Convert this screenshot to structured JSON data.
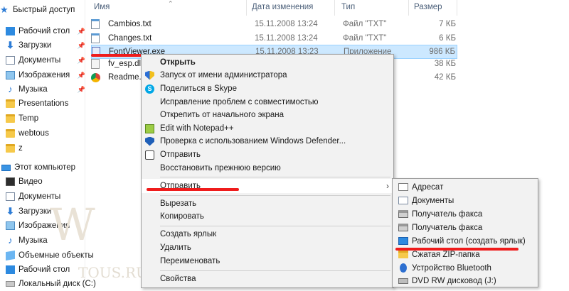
{
  "nav": {
    "items": [
      {
        "label": "Быстрый доступ",
        "icon": "star-icon",
        "pinned": false
      },
      {
        "label": "Рабочий стол",
        "icon": "desktop-icon",
        "pinned": true
      },
      {
        "label": "Загрузки",
        "icon": "download-icon",
        "pinned": true
      },
      {
        "label": "Документы",
        "icon": "documents-icon",
        "pinned": true
      },
      {
        "label": "Изображения",
        "icon": "pictures-icon",
        "pinned": true
      },
      {
        "label": "Музыка",
        "icon": "music-icon",
        "pinned": true
      },
      {
        "label": "Presentations",
        "icon": "folder-icon",
        "pinned": false
      },
      {
        "label": "Temp",
        "icon": "folder-icon",
        "pinned": false
      },
      {
        "label": "webtous",
        "icon": "folder-icon",
        "pinned": false
      },
      {
        "label": "z",
        "icon": "folder-icon",
        "pinned": false
      },
      {
        "label": "Этот компьютер",
        "icon": "computer-icon",
        "pinned": false
      },
      {
        "label": "Видео",
        "icon": "video-icon",
        "pinned": false
      },
      {
        "label": "Документы",
        "icon": "documents-icon",
        "pinned": false
      },
      {
        "label": "Загрузки",
        "icon": "download-icon",
        "pinned": false
      },
      {
        "label": "Изображения",
        "icon": "pictures-icon",
        "pinned": false
      },
      {
        "label": "Музыка",
        "icon": "music-icon",
        "pinned": false
      },
      {
        "label": "Объемные объекты",
        "icon": "3d-objects-icon",
        "pinned": false
      },
      {
        "label": "Рабочий стол",
        "icon": "desktop-icon",
        "pinned": false
      },
      {
        "label": "Локальный диск (C:)",
        "icon": "drive-icon",
        "pinned": false
      }
    ]
  },
  "columns": {
    "name": "Имя",
    "date": "Дата изменения",
    "type": "Тип",
    "size": "Размер"
  },
  "files": [
    {
      "name": "Cambios.txt",
      "date": "15.11.2008 13:24",
      "type": "Файл \"TXT\"",
      "size": "7 КБ",
      "icon": "text-file-icon"
    },
    {
      "name": "Changes.txt",
      "date": "15.11.2008 13:24",
      "type": "Файл \"TXT\"",
      "size": "6 КБ",
      "icon": "text-file-icon"
    },
    {
      "name": "FontViewer.exe",
      "date": "15.11.2008 13:23",
      "type": "Приложение",
      "size": "986 КБ",
      "icon": "exe-file-icon"
    },
    {
      "name": "fv_esp.dll",
      "date": "",
      "type": "",
      "size": "38 КБ",
      "icon": "dll-file-icon"
    },
    {
      "name": "Readme.h",
      "date": "",
      "type": "",
      "size": "42 КБ",
      "icon": "chrome-file-icon"
    }
  ],
  "context_menu": {
    "items": [
      {
        "label": "Открыть",
        "icon": "",
        "bold": true
      },
      {
        "label": "Запуск от имени администратора",
        "icon": "uac-shield-icon"
      },
      {
        "label": "Поделиться в Skype",
        "icon": "skype-icon"
      },
      {
        "label": "Исправление проблем с совместимостью",
        "icon": ""
      },
      {
        "label": "Открепить от начального экрана",
        "icon": ""
      },
      {
        "label": "Edit with Notepad++",
        "icon": "notepad-plus-icon"
      },
      {
        "label": "Проверка с использованием Windows Defender...",
        "icon": "defender-icon"
      },
      {
        "label": "Отправить",
        "icon": "share-icon"
      },
      {
        "label": "Восстановить прежнюю версию",
        "icon": ""
      },
      {
        "label": "Отправить",
        "icon": "",
        "submenu": true
      },
      {
        "label": "Вырезать",
        "icon": ""
      },
      {
        "label": "Копировать",
        "icon": ""
      },
      {
        "label": "Создать ярлык",
        "icon": ""
      },
      {
        "label": "Удалить",
        "icon": ""
      },
      {
        "label": "Переименовать",
        "icon": ""
      },
      {
        "label": "Свойства",
        "icon": ""
      }
    ]
  },
  "submenu": {
    "items": [
      {
        "label": "Адресат",
        "icon": "mail-recipient-icon"
      },
      {
        "label": "Документы",
        "icon": "documents-icon"
      },
      {
        "label": "Получатель факса",
        "icon": "fax-icon"
      },
      {
        "label": "Получатель факса",
        "icon": "fax-icon"
      },
      {
        "label": "Рабочий стол (создать ярлык)",
        "icon": "desktop-shortcut-icon"
      },
      {
        "label": "Сжатая ZIP-папка",
        "icon": "zip-folder-icon"
      },
      {
        "label": "Устройство Bluetooth",
        "icon": "bluetooth-icon"
      },
      {
        "label": "DVD RW дисковод (J:)",
        "icon": "dvd-drive-icon"
      }
    ]
  },
  "watermark": {
    "letter": "W",
    "text": "TOUS.RU"
  },
  "colors": {
    "selection": "#cce8ff",
    "annotation": "#ef1c1c",
    "menu_bg": "#f2f2f2"
  }
}
